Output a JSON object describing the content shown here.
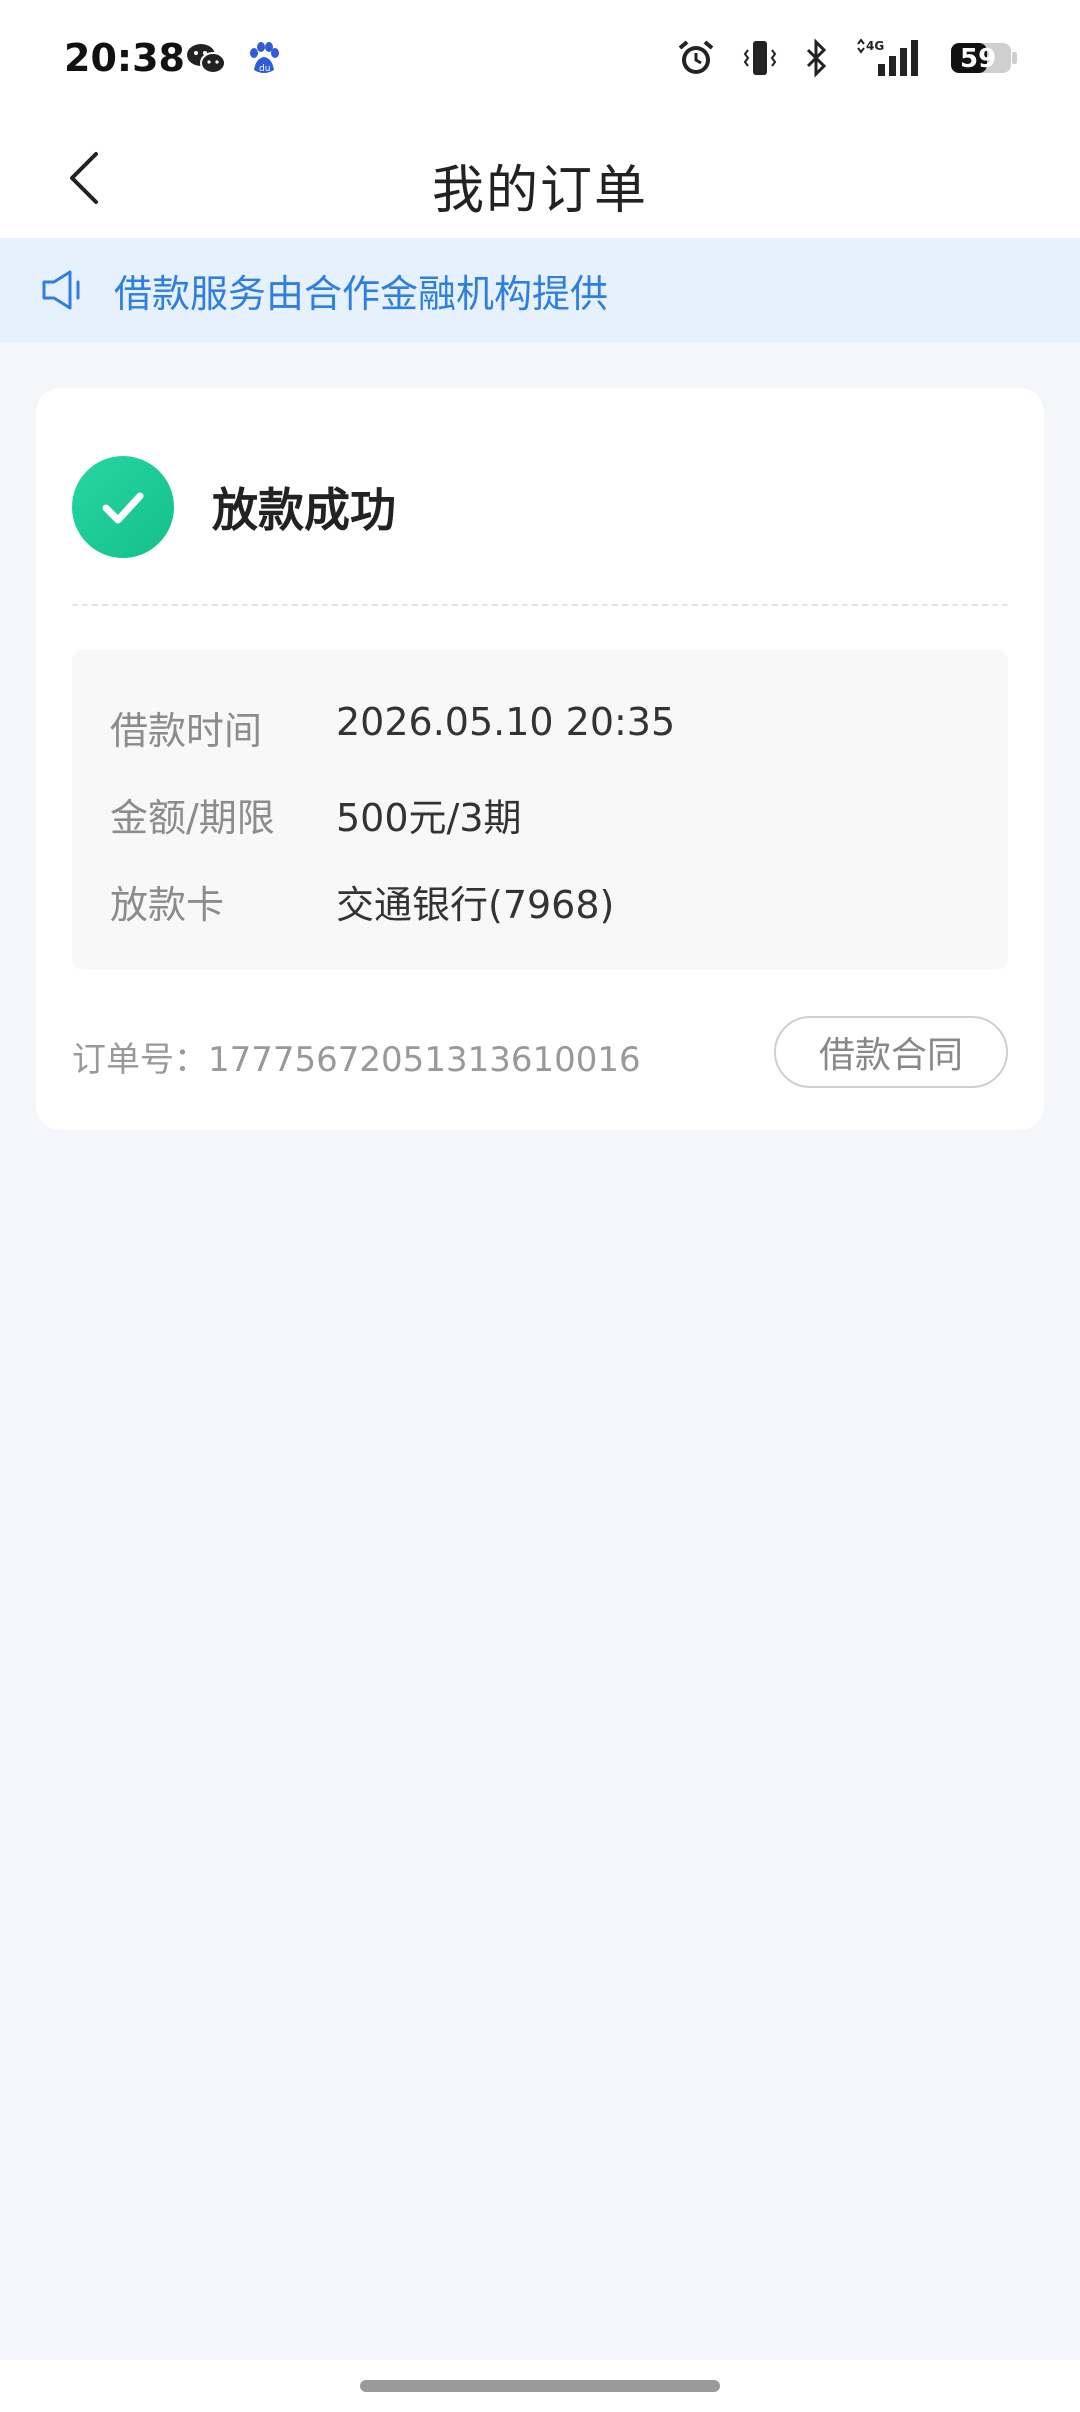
{
  "status_bar": {
    "time": "20:38",
    "left_icons": [
      "wechat-icon",
      "baidu-icon"
    ],
    "right_icons": [
      "alarm-icon",
      "vibrate-icon",
      "bluetooth-icon",
      "signal-4g-icon",
      "battery-icon"
    ],
    "network_label": "4G",
    "battery": "59"
  },
  "nav": {
    "title": "我的订单",
    "back_icon": "chevron-left-icon"
  },
  "notice": {
    "icon": "speaker-icon",
    "text": "借款服务由合作金融机构提供"
  },
  "order": {
    "status_icon": "check-circle-icon",
    "status": "放款成功",
    "details": [
      {
        "label": "借款时间",
        "value": "2026.05.10 20:35"
      },
      {
        "label": "金额/期限",
        "value": "500元/3期"
      },
      {
        "label": "放款卡",
        "value": "交通银行(7968)"
      }
    ],
    "order_number_text": "订单号：1777567205131361​0016",
    "contract_button": "借款合同"
  },
  "colors": {
    "accent_blue": "#2d7fe0",
    "banner_bg": "#e7f1fd",
    "success_green": "#1cc894",
    "page_bg": "#f4f6f9"
  }
}
